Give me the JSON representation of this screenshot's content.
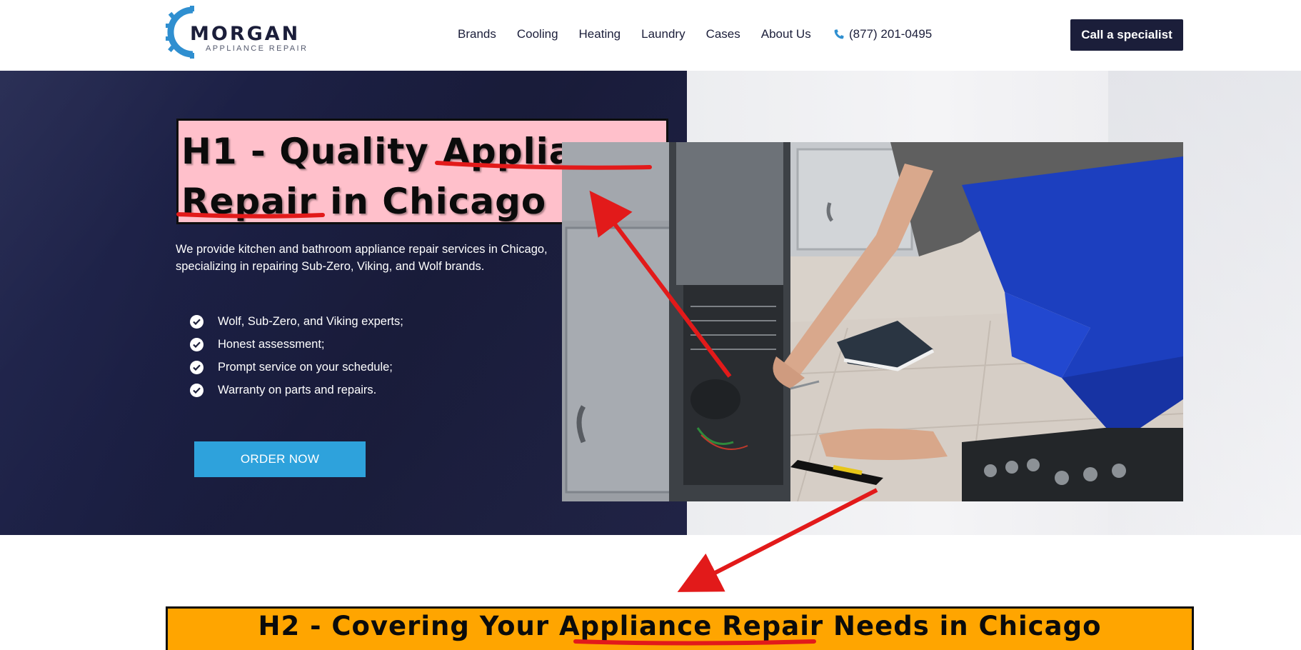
{
  "header": {
    "logo_word": "MORGAN",
    "logo_sub": "APPLIANCE REPAIR",
    "nav": [
      {
        "label": "Brands"
      },
      {
        "label": "Cooling"
      },
      {
        "label": "Heating"
      },
      {
        "label": "Laundry"
      },
      {
        "label": "Cases"
      },
      {
        "label": "About Us"
      }
    ],
    "phone": "(877) 201-0495",
    "phone_icon": "phone-icon",
    "cta_label": "Call a specialist"
  },
  "hero": {
    "h1_line1": "H1 - Quality Appliance",
    "h1_line2": "Repair in Chicago",
    "description": "We provide kitchen and bathroom appliance repair services in Chicago, specializing in repairing Sub-Zero, Viking, and Wolf brands.",
    "checklist": [
      "Wolf, Sub-Zero, and Viking experts;",
      "Honest assessment;",
      "Prompt service on your schedule;",
      "Warranty on parts and repairs."
    ],
    "order_label": "ORDER NOW"
  },
  "h2": {
    "text": "H2 - Covering Your Appliance Repair Needs in Chicago"
  },
  "colors": {
    "navy": "#1b1e3a",
    "accent_blue": "#2ea2dc",
    "h1_highlight": "#ffc0cb",
    "h2_highlight": "#ffa500",
    "annotation_red": "#e21a1a"
  }
}
